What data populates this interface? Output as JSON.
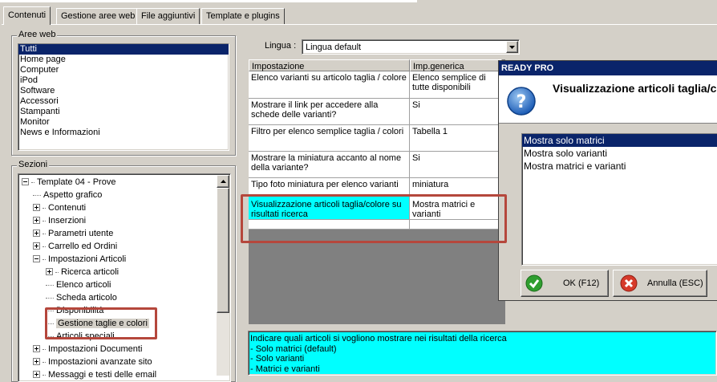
{
  "tabs": [
    {
      "label": "Contenuti",
      "active": true
    },
    {
      "label": "Gestione aree web",
      "active": false
    },
    {
      "label": "File aggiuntivi",
      "active": false
    },
    {
      "label": "Template e plugins",
      "active": false
    }
  ],
  "aree_web": {
    "title": "Aree web",
    "items": [
      "Tutti",
      "Home page",
      "Computer",
      "iPod",
      "Software",
      "Accessori",
      "Stampanti",
      "Monitor",
      "News e Informazioni"
    ]
  },
  "sezioni": {
    "title": "Sezioni",
    "tree": [
      {
        "label": "Template 04 - Prove",
        "level": 0,
        "expander": "minus"
      },
      {
        "label": "Aspetto grafico",
        "level": 1,
        "expander": "none"
      },
      {
        "label": "Contenuti",
        "level": 1,
        "expander": "plus"
      },
      {
        "label": "Inserzioni",
        "level": 1,
        "expander": "plus"
      },
      {
        "label": "Parametri utente",
        "level": 1,
        "expander": "plus"
      },
      {
        "label": "Carrello ed Ordini",
        "level": 1,
        "expander": "plus"
      },
      {
        "label": "Impostazioni Articoli",
        "level": 1,
        "expander": "minus"
      },
      {
        "label": "Ricerca articoli",
        "level": 2,
        "expander": "plus"
      },
      {
        "label": "Elenco articoli",
        "level": 2,
        "expander": "none"
      },
      {
        "label": "Scheda articolo",
        "level": 2,
        "expander": "none"
      },
      {
        "label": "Disponibilità",
        "level": 2,
        "expander": "none"
      },
      {
        "label": "Gestione taglie e colori",
        "level": 2,
        "expander": "none",
        "selected": true
      },
      {
        "label": "Articoli speciali",
        "level": 2,
        "expander": "none"
      },
      {
        "label": "Impostazioni Documenti",
        "level": 1,
        "expander": "plus"
      },
      {
        "label": "Impostazioni avanzate sito",
        "level": 1,
        "expander": "plus"
      },
      {
        "label": "Messaggi e testi delle email",
        "level": 1,
        "expander": "plus"
      }
    ]
  },
  "lingua": {
    "label": "Lingua :",
    "value": "Lingua default"
  },
  "grid": {
    "headers": [
      "Impostazione",
      "Imp.generica"
    ],
    "rows": [
      {
        "setting": "Elenco varianti su articolo taglia / colore",
        "value": "Elenco semplice di tutte disponibili"
      },
      {
        "setting": "Mostrare il link per accedere alla schede delle varianti?",
        "value": "Si"
      },
      {
        "setting": "Filtro per elenco semplice taglia / colori",
        "value": "Tabella 1"
      },
      {
        "setting": "Mostrare la miniatura accanto al nome della variante?",
        "value": "Si"
      },
      {
        "setting": "Tipo foto miniatura per elenco varianti",
        "value": "miniatura"
      },
      {
        "setting": "Visualizzazione articoli taglia/colore su risultati ricerca",
        "value": "Mostra matrici e varianti",
        "selected": true
      }
    ]
  },
  "description": {
    "lines": [
      "Indicare quali articoli si vogliono mostrare nei risultati della ricerca",
      "- Solo matrici (default)",
      "- Solo varianti",
      "- Matrici e varianti"
    ]
  },
  "dialog": {
    "title": "READY PRO",
    "heading": "Visualizzazione articoli taglia/co",
    "options": [
      "Mostra solo matrici",
      "Mostra solo varianti",
      "Mostra matrici e varianti"
    ],
    "ok_label": "OK (F12)",
    "cancel_label": "Annulla (ESC)"
  },
  "colors": {
    "selection": "#0a246a",
    "cyan": "#00ffff",
    "highlight": "#b5473c"
  }
}
